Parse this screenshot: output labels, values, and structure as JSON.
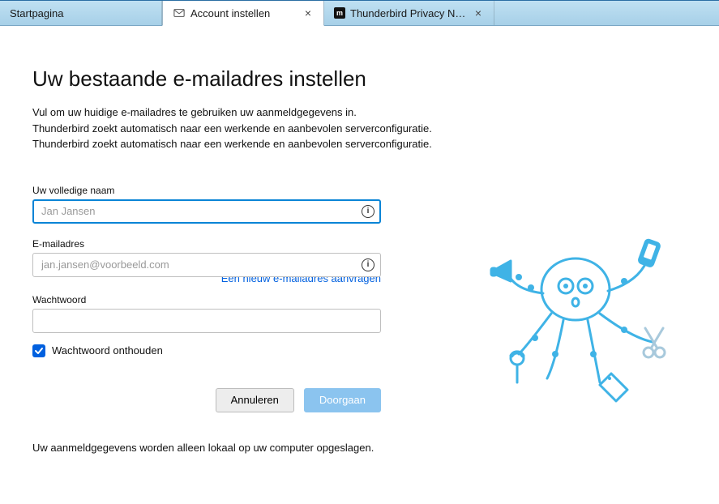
{
  "tabs": [
    {
      "label": "Startpagina",
      "closable": false
    },
    {
      "label": "Account instellen",
      "closable": true,
      "active": true,
      "icon": "mail"
    },
    {
      "label": "Thunderbird Privacy Notice",
      "closable": true,
      "icon": "m"
    }
  ],
  "heading": "Uw bestaande e-mailadres instellen",
  "intro_lines": [
    "Vul om uw huidige e-mailadres te gebruiken uw aanmeldgegevens in.",
    "Thunderbird zoekt automatisch naar een werkende en aanbevolen serverconfiguratie.",
    "Thunderbird zoekt automatisch naar een werkende en aanbevolen serverconfiguratie."
  ],
  "form": {
    "name_label": "Uw volledige naam",
    "name_placeholder": "Jan Jansen",
    "name_value": "",
    "email_label": "E-mailadres",
    "email_placeholder": "jan.jansen@voorbeeld.com",
    "email_value": "",
    "link_text": "Een nieuw e-mailadres aanvragen",
    "password_label": "Wachtwoord",
    "password_value": "",
    "remember_label": "Wachtwoord onthouden",
    "remember_checked": true,
    "cancel_label": "Annuleren",
    "continue_label": "Doorgaan"
  },
  "footnote": "Uw aanmeldgegevens worden alleen lokaal op uw computer opgeslagen.",
  "colors": {
    "accent": "#0060df",
    "illus": "#3fb3e6"
  }
}
